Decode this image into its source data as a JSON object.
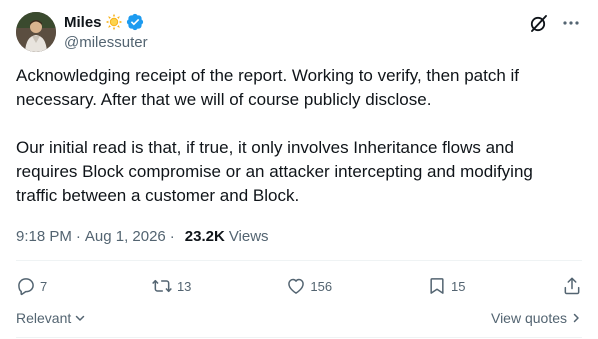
{
  "author": {
    "display_name": "Miles",
    "handle": "@milessuter",
    "avatar_icon": "profile-photo",
    "badge_icon": "sun-emoji-icon",
    "verified_icon": "verified-badge-icon",
    "verified_color": "#1d9bf0"
  },
  "post": {
    "text": "Acknowledging receipt of the report. Working to verify, then patch if necessary. After that we will of course publicly disclose.\n\nOur initial read is that, if true, it only involves Inheritance flows and requires Block compromise or an attacker intercepting and modifying traffic between a customer and Block.",
    "time": "9:18 PM",
    "separator": "·",
    "date": "Aug 1, 2026",
    "views_count": "23.2K",
    "views_label": "Views"
  },
  "actions": {
    "replies": "7",
    "reposts": "13",
    "likes": "156",
    "bookmarks": "15"
  },
  "footer": {
    "sort_label": "Relevant",
    "view_quotes_label": "View quotes"
  },
  "colors": {
    "text": "#0f1419",
    "secondary": "#536471",
    "divider": "#eff3f4"
  }
}
